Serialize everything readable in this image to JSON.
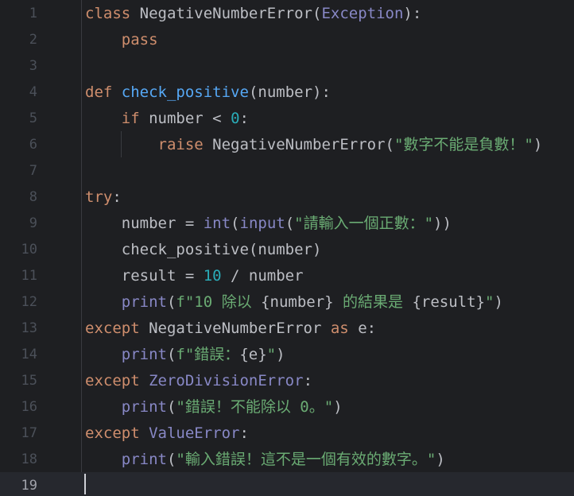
{
  "editor": {
    "lines": [
      {
        "n": "1"
      },
      {
        "n": "2"
      },
      {
        "n": "3"
      },
      {
        "n": "4"
      },
      {
        "n": "5"
      },
      {
        "n": "6"
      },
      {
        "n": "7"
      },
      {
        "n": "8"
      },
      {
        "n": "9"
      },
      {
        "n": "10"
      },
      {
        "n": "11"
      },
      {
        "n": "12"
      },
      {
        "n": "13"
      },
      {
        "n": "14"
      },
      {
        "n": "15"
      },
      {
        "n": "16"
      },
      {
        "n": "17"
      },
      {
        "n": "18"
      },
      {
        "n": "19"
      }
    ],
    "code": {
      "l1": {
        "kw": "class",
        "name": "NegativeNumberError",
        "open": "(",
        "base": "Exception",
        "close": "):"
      },
      "l2": {
        "kw": "pass"
      },
      "l4": {
        "kw": "def",
        "name": "check_positive",
        "rest": "(number):"
      },
      "l5": {
        "kw": "if",
        "mid": "number <",
        "num": "0",
        "end": ":"
      },
      "l6": {
        "kw": "raise",
        "mid": "NegativeNumberError(",
        "str": "\"數字不能是負數！\"",
        "end": ")"
      },
      "l8": {
        "kw": "try",
        "end": ":"
      },
      "l9": {
        "a": "number = ",
        "b1": "int",
        "b2": "(",
        "b3": "input",
        "b4": "(",
        "str": "\"請輸入一個正數：\"",
        "end": "))"
      },
      "l10": {
        "text": "check_positive(number)"
      },
      "l11": {
        "a": "result = ",
        "num": "10",
        "b": " / number"
      },
      "l12": {
        "bi": "print",
        "p": "(",
        "s1": "f\"10 除以 ",
        "e1": "{number}",
        "s2": " 的結果是 ",
        "e2": "{result}",
        "s3": "\"",
        "end": ")"
      },
      "l13": {
        "kw": "except",
        "mid": " NegativeNumberError ",
        "as": "as",
        "end": " e:"
      },
      "l14": {
        "bi": "print",
        "p": "(",
        "s1": "f\"錯誤：",
        "e1": "{e}",
        "s2": "\"",
        "end": ")"
      },
      "l15": {
        "kw": "except",
        "cls": "ZeroDivisionError",
        "end": ":"
      },
      "l16": {
        "bi": "print",
        "p": "(",
        "str": "\"錯誤！不能除以 0。\"",
        "end": ")"
      },
      "l17": {
        "kw": "except",
        "cls": "ValueError",
        "end": ":"
      },
      "l18": {
        "bi": "print",
        "p": "(",
        "str": "\"輸入錯誤！這不是一個有效的數字。\"",
        "end": ")"
      }
    }
  }
}
